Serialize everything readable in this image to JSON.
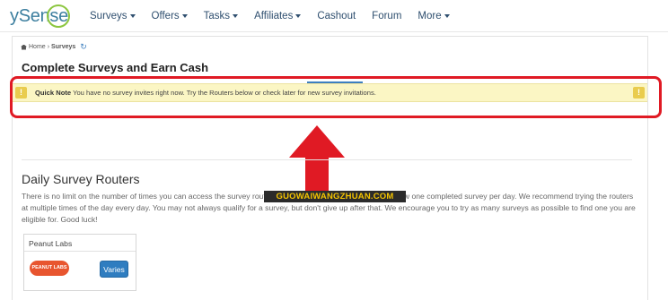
{
  "logo": {
    "text": "ySense"
  },
  "nav": {
    "items": [
      {
        "label": "Surveys",
        "dropdown": true
      },
      {
        "label": "Offers",
        "dropdown": true
      },
      {
        "label": "Tasks",
        "dropdown": true
      },
      {
        "label": "Affiliates",
        "dropdown": true
      },
      {
        "label": "Cashout",
        "dropdown": false
      },
      {
        "label": "Forum",
        "dropdown": false
      },
      {
        "label": "More",
        "dropdown": true
      }
    ]
  },
  "breadcrumb": {
    "home": "Home",
    "separator": "›",
    "current": "Surveys",
    "refresh_icon": "refresh-icon"
  },
  "page": {
    "title": "Complete Surveys and Earn Cash"
  },
  "alert": {
    "label": "Quick Note",
    "message": "You have no survey invites right now. Try the Routers below or check later for new survey invitations.",
    "icon": "warning-icon"
  },
  "section": {
    "title": "Daily Survey Routers",
    "body": "There is no limit on the number of times you can access the survey routers every day, but some routers only allow one completed survey per day. We recommend trying the routers at multiple times of the day every day. You may not always qualify for a survey, but don't give up after that. We encourage you to try as many surveys as possible to find one you are eligible for. Good luck!"
  },
  "watermark": {
    "text": "GUOWAIWANGZHUAN.COM"
  },
  "router": {
    "name": "Peanut Labs",
    "logo_text": "PEANUT LABS",
    "button_label": "Varies"
  },
  "colors": {
    "accent": "#3d7fbf",
    "alert_bg": "#fbf6c4",
    "highlight": "#e01a24",
    "button": "#2f7dc0",
    "logo_ring": "#8cc63f"
  }
}
